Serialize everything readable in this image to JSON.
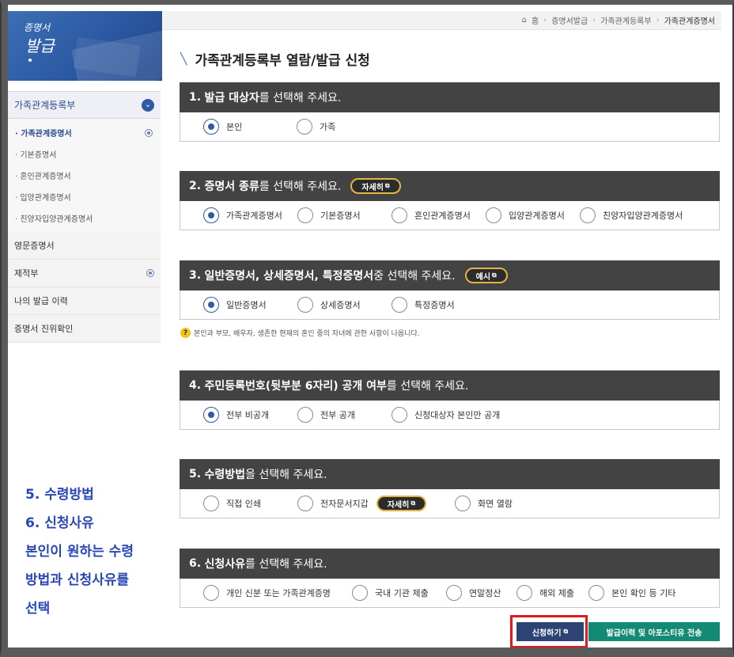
{
  "banner": {
    "line1": "증명서",
    "line2": "발급"
  },
  "breadcrumb": {
    "home": "홈",
    "items": [
      "증명서발급",
      "가족관계등록부",
      "가족관계증명서"
    ],
    "home_icon": "home-icon"
  },
  "sidebar": {
    "section_title": "가족관계등록부",
    "sub_items": [
      "· 가족관계증명서",
      "· 기본증명서",
      "· 혼인관계증명서",
      "· 입양관계증명서",
      "· 친양자입양관계증명서"
    ],
    "items": [
      "영문증명서",
      "제적부",
      "나의 발급 이력",
      "증명서 진위확인"
    ]
  },
  "annotation": {
    "lines": [
      "5. 수령방법",
      "6. 신청사유",
      "본인이 원하는 수령",
      "방법과 신청사유를",
      "선택"
    ]
  },
  "page_title": "가족관계등록부 열람/발급 신청",
  "sections": [
    {
      "num": "1.",
      "bold": "발급 대상자",
      "rest": "를 선택해 주세요.",
      "options": [
        "본인",
        "가족"
      ]
    },
    {
      "num": "2.",
      "bold": "증명서 종류",
      "rest": "를 선택해 주세요.",
      "pill": "자세히",
      "options": [
        "가족관계증명서",
        "기본증명서",
        "혼인관계증명서",
        "입양관계증명서",
        "친양자입양관계증명서"
      ]
    },
    {
      "num": "3.",
      "bold": "일반증명서, 상세증명서, 특정증명서",
      "rest": " 중 선택해 주세요.",
      "pill": "예시",
      "options": [
        "일반증명서",
        "상세증명서",
        "특정증명서"
      ]
    },
    {
      "num": "4.",
      "bold": "주민등록번호(뒷부분 6자리) 공개 여부",
      "rest": "를 선택해 주세요.",
      "options": [
        "전부 비공개",
        "전부 공개",
        "신청대상자 본인만 공개"
      ]
    },
    {
      "num": "5.",
      "bold": "수령방법",
      "rest": "을 선택해 주세요.",
      "options": [
        "직접 인쇄",
        "전자문서지갑",
        "화면 열람"
      ],
      "inline_pill": "자세히"
    },
    {
      "num": "6.",
      "bold": "신청사유",
      "rest": "를 선택해 주세요.",
      "options": [
        "개인 신분 또는 가족관계증명",
        "국내 기관 제출",
        "연말정산",
        "해외 제출",
        "본인 확인 등 기타"
      ]
    }
  ],
  "note": "본인과 부모, 배우자, 생존한 현재의 혼인 중의 자녀에 관한 사항이 나옵니다.",
  "buttons": {
    "apply": "신청하기",
    "history": "발급이력 및 아포스티유 전송"
  },
  "colors": {
    "header_dark": "#434343",
    "accent_blue": "#2f5aa5",
    "pill_border": "#e2b545",
    "green": "#138a74",
    "navy": "#2d4373",
    "highlight": "#e0191f"
  }
}
